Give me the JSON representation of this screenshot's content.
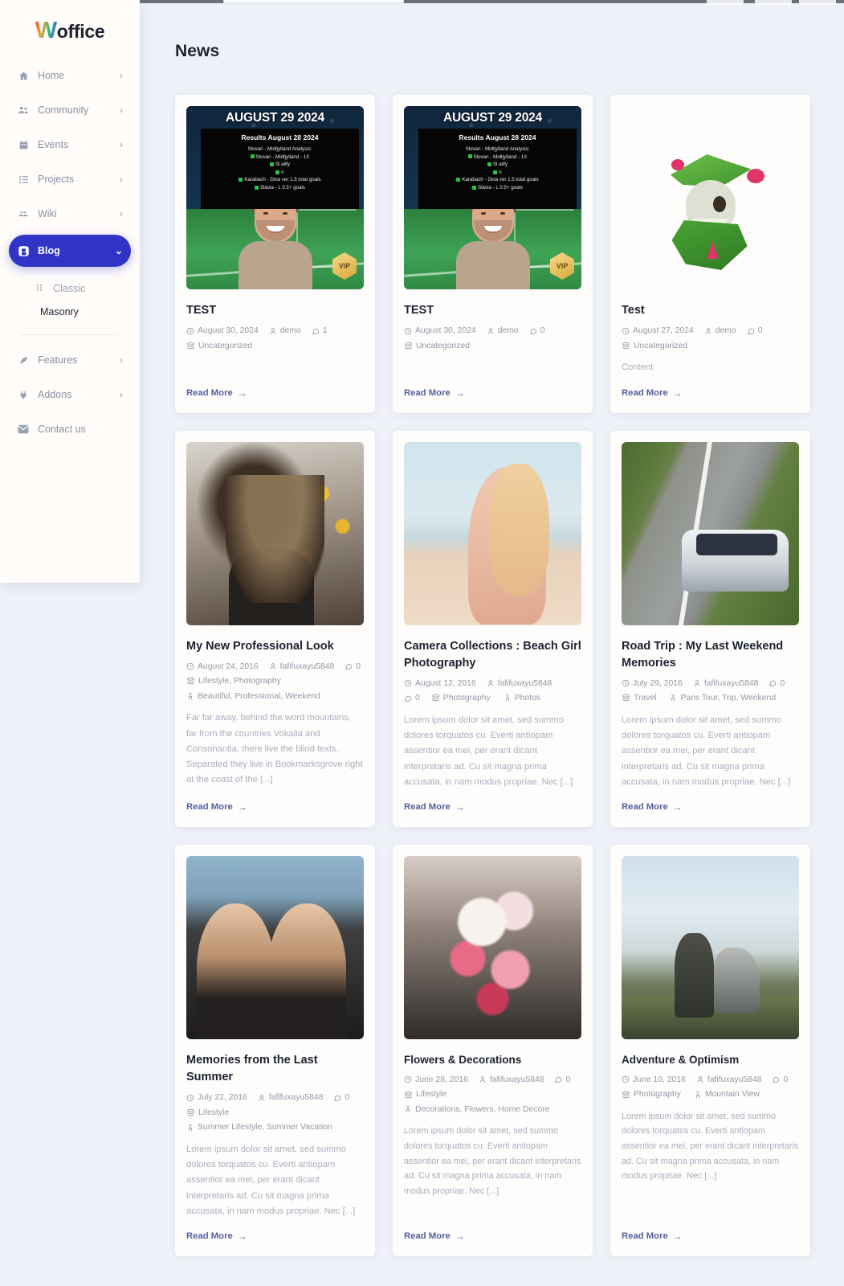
{
  "brand": {
    "initial": "W",
    "rest": "office"
  },
  "colors": {
    "accent": "#3034c7",
    "page_bg": "#eef1f7",
    "sidebar_bg": "#fffcfa",
    "card_bg": "#fffdfb",
    "readmore": "#555f9e",
    "meta_text": "#9298a8"
  },
  "sidebar": {
    "items": [
      {
        "label": "Home",
        "icon": "home-icon",
        "chevron": "›",
        "active": false
      },
      {
        "label": "Community",
        "icon": "people-icon",
        "chevron": "›",
        "active": false
      },
      {
        "label": "Events",
        "icon": "calendar-icon",
        "chevron": "›",
        "active": false
      },
      {
        "label": "Projects",
        "icon": "list-icon",
        "chevron": "›",
        "active": false
      },
      {
        "label": "Wiki",
        "icon": "book-icon",
        "chevron": "›",
        "active": false
      },
      {
        "label": "Blog",
        "icon": "blog-icon",
        "chevron": "⌄",
        "active": true
      }
    ],
    "sub_items": [
      {
        "label": "Classic",
        "icon": "grid-dots-icon",
        "current": false
      },
      {
        "label": "Masonry",
        "icon": "",
        "current": true
      }
    ],
    "items_bottom": [
      {
        "label": "Features",
        "icon": "feather-icon",
        "chevron": "›"
      },
      {
        "label": "Addons",
        "icon": "plug-icon",
        "chevron": "›"
      },
      {
        "label": "Contact us",
        "icon": "mail-icon",
        "chevron": ""
      }
    ]
  },
  "main": {
    "page_title": "News",
    "read_more_label": "Read More",
    "read_more_arrow": "→"
  },
  "posts": [
    {
      "title": "TEST",
      "date": "August 30, 2024",
      "author": "demo",
      "comments": "1",
      "category": "Uncategorized",
      "tags": "",
      "excerpt": "",
      "thumb": "sports-tv-thumbnail",
      "thumb_overlay": {
        "headline": "AUGUST 29 2024",
        "panel_title": "Results August 28 2024",
        "panel_lines": [
          "Slovan - Midtjylland Analysis:",
          "Slovan - Midtjylland - 1X",
          "Sl          alify",
          "n",
          "Karabach - Dina        ver 1.5 total goals",
          "Slavia - L           0.5+ goals"
        ],
        "badge": "VIP"
      }
    },
    {
      "title": "TEST",
      "date": "August 30, 2024",
      "author": "demo",
      "comments": "0",
      "category": "Uncategorized",
      "tags": "",
      "excerpt": "",
      "thumb": "sports-tv-thumbnail",
      "thumb_overlay": {
        "headline": "AUGUST 29 2024",
        "panel_title": "Results August 28 2024",
        "panel_lines": [
          "Slovan - Midtjylland Analysis:",
          "Slovan - Midtjylland - 1X",
          "Sl          alify",
          "n",
          "Karabach - Dina        ver 1.5 total goals",
          "Slavia - L           0.5+ goals"
        ],
        "badge": "VIP"
      }
    },
    {
      "title": "Test",
      "date": "August 27, 2024",
      "author": "demo",
      "comments": "0",
      "category": "Uncategorized",
      "tags": "",
      "excerpt": "Content",
      "thumb": "green-monster-figure"
    },
    {
      "title": "My New Professional Look",
      "date": "August 24, 2016",
      "author": "fafifuxayu5848",
      "comments": "0",
      "category": "Lifestyle, Photography",
      "tags": "Beautiful, Professional, Weekend",
      "excerpt": "Far far away, behind the word mountains, far from the countries Vokalia and Consonantia, there live the blind texts. Separated they live in Bookmarksgrove right at the coast of the [...]",
      "thumb": "woman-autumn-hair-photo"
    },
    {
      "title": "Camera Collections : Beach Girl Photography",
      "date": "August 12, 2016",
      "author": "fafifuxayu5848",
      "comments": "0",
      "category": "Photography",
      "tags": "Photos",
      "excerpt": "Lorem ipsum dolor sit amet, sed summo dolores torquatos cu. Everti antiopam assentior ea mei, per erant dicant interpretaris ad. Cu sit magna prima accusata, in nam modus propriae. Nec [...]",
      "thumb": "beach-girl-photo"
    },
    {
      "title": "Road Trip : My Last Weekend Memories",
      "date": "July 29, 2016",
      "author": "fafifuxayu5848",
      "comments": "0",
      "category": "Travel",
      "tags": "Paris Tour, Trip, Weekend",
      "excerpt": "Lorem ipsum dolor sit amet, sed summo dolores torquatos cu. Everti antiopam assentior ea mei, per erant dicant interpretaris ad. Cu sit magna prima accusata, in nam modus propriae. Nec [...]",
      "thumb": "road-trip-car-photo"
    },
    {
      "title": "Memories from the Last Summer",
      "date": "July 22, 2016",
      "author": "fafifuxayu5848",
      "comments": "0",
      "category": "Lifestyle",
      "tags": "Summer Lifestyle, Summer Vacation",
      "excerpt": "Lorem ipsum dolor sit amet, sed summo dolores torquatos cu. Everti antiopam assentior ea mei, per erant dicant interpretaris ad. Cu sit magna prima accusata, in nam modus propriae. Nec [...]",
      "thumb": "two-women-photo"
    },
    {
      "title": "Flowers & Decorations",
      "date": "June 28, 2016",
      "author": "fafifuxayu5848",
      "comments": "0",
      "category": "Lifestyle",
      "tags": "Decorations, Flowers, Home Decore",
      "excerpt": "Lorem ipsum dolor sit amet, sed summo dolores torquatos cu. Everti antiopam assentior ea mei, per erant dicant interpretaris ad. Cu sit magna prima accusata, in nam modus propriae. Nec [...]",
      "thumb": "flower-bouquet-photo"
    },
    {
      "title": "Adventure & Optimism",
      "date": "June 10, 2016",
      "author": "fafifuxayu5848",
      "comments": "0",
      "category": "Photography",
      "tags": "Mountain View",
      "excerpt": "Lorem ipsum dolor sit amet, sed summo dolores torquatos cu. Everti antiopam assentior ea mei, per erant dicant interpretaris ad. Cu sit magna prima accusata, in nam modus propriae. Nec [...]",
      "thumb": "woman-dog-mountain-photo"
    }
  ]
}
